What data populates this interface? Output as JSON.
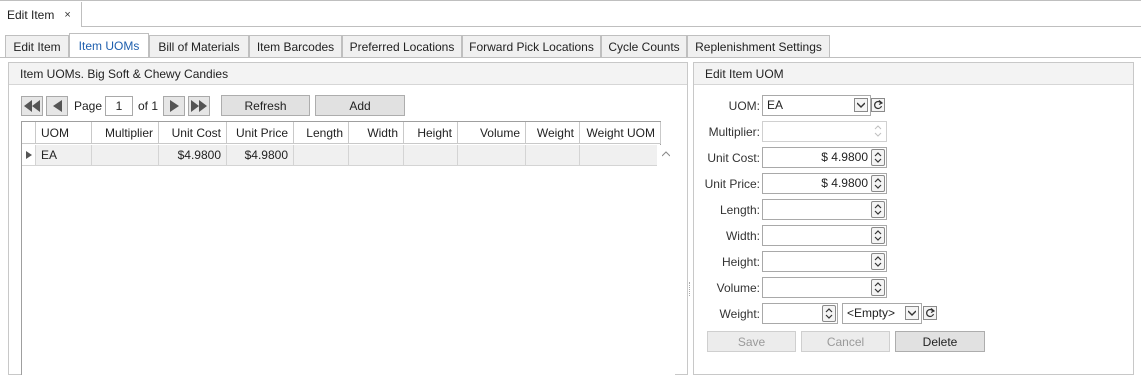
{
  "document_tab": {
    "label": "Edit Item",
    "close_glyph": "×"
  },
  "tabs": [
    {
      "label": "Edit Item"
    },
    {
      "label": "Item UOMs",
      "active": true
    },
    {
      "label": "Bill of Materials"
    },
    {
      "label": "Item Barcodes"
    },
    {
      "label": "Preferred Locations"
    },
    {
      "label": "Forward Pick Locations"
    },
    {
      "label": "Cycle Counts"
    },
    {
      "label": "Replenishment Settings"
    }
  ],
  "left_panel": {
    "title": "Item UOMs. Big Soft & Chewy Candies",
    "pager": {
      "page_label": "Page",
      "page_value": "1",
      "of_label": "of 1"
    },
    "buttons": {
      "refresh": "Refresh",
      "add": "Add"
    },
    "columns": [
      "UOM",
      "Multiplier",
      "Unit Cost",
      "Unit Price",
      "Length",
      "Width",
      "Height",
      "Volume",
      "Weight",
      "Weight UOM"
    ],
    "rows": [
      {
        "uom": "EA",
        "multiplier": "",
        "unit_cost": "$4.9800",
        "unit_price": "$4.9800",
        "length": "",
        "width": "",
        "height": "",
        "volume": "",
        "weight": "",
        "weight_uom": ""
      }
    ]
  },
  "right_panel": {
    "title": "Edit Item UOM",
    "labels": {
      "uom": "UOM:",
      "multiplier": "Multiplier:",
      "unit_cost": "Unit Cost:",
      "unit_price": "Unit Price:",
      "length": "Length:",
      "width": "Width:",
      "height": "Height:",
      "volume": "Volume:",
      "weight": "Weight:"
    },
    "values": {
      "uom": "EA",
      "multiplier": "",
      "unit_cost": "$ 4.9800",
      "unit_price": "$ 4.9800",
      "length": "",
      "width": "",
      "height": "",
      "volume": "",
      "weight": "",
      "weight_uom": "<Empty>"
    },
    "buttons": {
      "save": "Save",
      "cancel": "Cancel",
      "delete": "Delete"
    }
  }
}
